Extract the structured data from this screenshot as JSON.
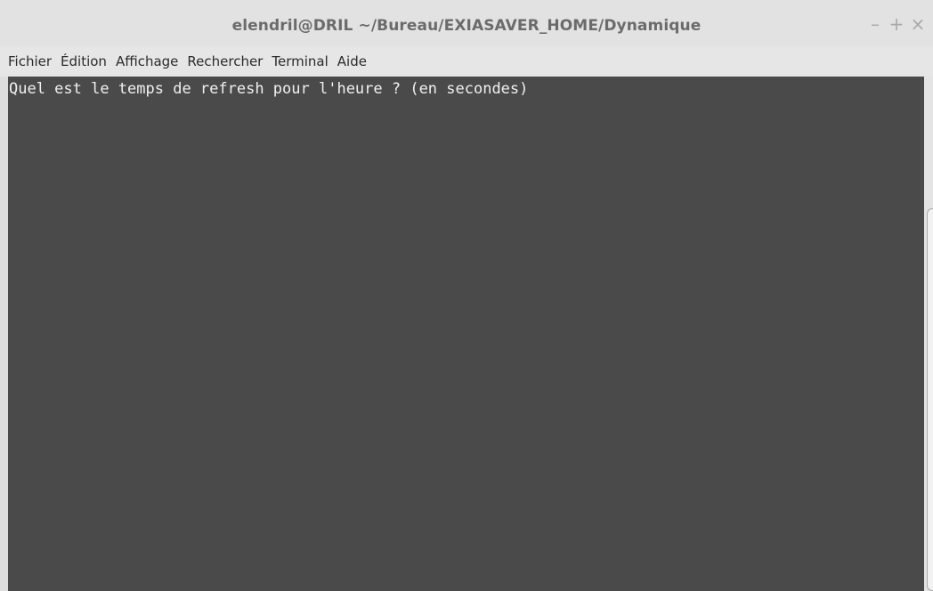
{
  "window": {
    "title": "elendril@DRIL ~/Bureau/EXIASAVER_HOME/Dynamique",
    "controls": {
      "minimize": "–",
      "maximize": "+",
      "close": "×"
    }
  },
  "menubar": {
    "items": [
      "Fichier",
      "Édition",
      "Affichage",
      "Rechercher",
      "Terminal",
      "Aide"
    ]
  },
  "terminal": {
    "lines": [
      "Quel est le temps de refresh pour l'heure ? (en secondes)"
    ],
    "background": "#4a4a4a",
    "foreground": "#f0f0f0"
  },
  "icons": {
    "minimize": "minimize-icon",
    "maximize": "maximize-icon",
    "close": "close-icon"
  }
}
